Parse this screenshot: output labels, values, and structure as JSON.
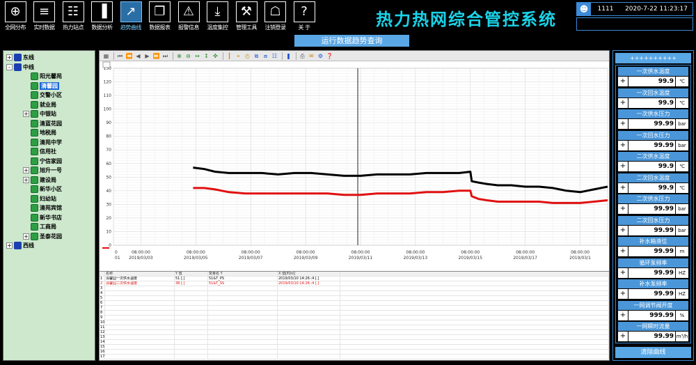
{
  "nav": [
    {
      "label": "全网分布",
      "icon": "globe-icon",
      "glyph": "⊕"
    },
    {
      "label": "实时数据",
      "icon": "document-icon",
      "glyph": "≡"
    },
    {
      "label": "热力站点",
      "icon": "network-icon",
      "glyph": "☷"
    },
    {
      "label": "数据分析",
      "icon": "bar-chart-icon",
      "glyph": "▐"
    },
    {
      "label": "趋势曲线",
      "icon": "trend-icon",
      "glyph": "↗"
    },
    {
      "label": "数据报表",
      "icon": "folder-icon",
      "glyph": "❐"
    },
    {
      "label": "报警信息",
      "icon": "warning-icon",
      "glyph": "⚠"
    },
    {
      "label": "温度集控",
      "icon": "download-icon",
      "glyph": "⤓"
    },
    {
      "label": "管理工具",
      "icon": "tools-icon",
      "glyph": "⚒"
    },
    {
      "label": "注销登录",
      "icon": "lock-icon",
      "glyph": "☖"
    },
    {
      "label": "关  于",
      "icon": "help-icon",
      "glyph": "?"
    }
  ],
  "active_nav": 4,
  "title": "热力热网综合管控系统",
  "user": {
    "id": "1111",
    "datetime": "2020-7-22 11:23:17"
  },
  "section_title": "运行数据趋势查询",
  "tree": [
    {
      "label": "东线",
      "level": 0,
      "expander": "+",
      "icon": "blue"
    },
    {
      "label": "中线",
      "level": 0,
      "expander": "-",
      "icon": "blue"
    },
    {
      "label": "阳光馨苑",
      "level": 1,
      "expander": "",
      "icon": "green"
    },
    {
      "label": "清馨园",
      "level": 1,
      "expander": "",
      "icon": "green",
      "selected": true
    },
    {
      "label": "交警小区",
      "level": 1,
      "expander": "",
      "icon": "green"
    },
    {
      "label": "就业局",
      "level": 1,
      "expander": "",
      "icon": "green"
    },
    {
      "label": "中银站",
      "level": 1,
      "expander": "+",
      "icon": "green"
    },
    {
      "label": "清蓝花园",
      "level": 1,
      "expander": "",
      "icon": "green"
    },
    {
      "label": "地税局",
      "level": 1,
      "expander": "",
      "icon": "green"
    },
    {
      "label": "清苑中学",
      "level": 1,
      "expander": "",
      "icon": "green"
    },
    {
      "label": "信用社",
      "level": 1,
      "expander": "",
      "icon": "green"
    },
    {
      "label": "宁信家园",
      "level": 1,
      "expander": "",
      "icon": "green"
    },
    {
      "label": "旭升一号",
      "level": 1,
      "expander": "+",
      "icon": "green"
    },
    {
      "label": "建设局",
      "level": 1,
      "expander": "+",
      "icon": "green"
    },
    {
      "label": "新华小区",
      "level": 1,
      "expander": "",
      "icon": "green"
    },
    {
      "label": "妇幼站",
      "level": 1,
      "expander": "",
      "icon": "green"
    },
    {
      "label": "清苑宾馆",
      "level": 1,
      "expander": "",
      "icon": "green"
    },
    {
      "label": "新华书店",
      "level": 1,
      "expander": "",
      "icon": "green"
    },
    {
      "label": "工商局",
      "level": 1,
      "expander": "",
      "icon": "green"
    },
    {
      "label": "圣泰花园",
      "level": 1,
      "expander": "+",
      "icon": "green"
    },
    {
      "label": "西线",
      "level": 0,
      "expander": "+",
      "icon": "blue"
    }
  ],
  "toolbar_icons": [
    "grid-icon",
    "first-icon",
    "prev-fast-icon",
    "prev-icon",
    "next-icon",
    "next-fast-icon",
    "last-icon",
    "zoom-in-icon",
    "zoom-out-icon",
    "zoom-x-icon",
    "zoom-y-icon",
    "pan-icon",
    "ruler-icon",
    "cursor-icon",
    "clock-icon",
    "copy-icon",
    "paste-icon",
    "table-icon",
    "pause-icon",
    "print-icon",
    "export-icon",
    "config-icon",
    "help-chart-icon"
  ],
  "chart_data": {
    "type": "line",
    "y_ticks": [
      0,
      10,
      20,
      30,
      40,
      50,
      60,
      70,
      80,
      90,
      100,
      110,
      120,
      130
    ],
    "ylim": [
      0,
      130
    ],
    "xlim": [
      0,
      18
    ],
    "x_tick_pairs": [
      {
        "pos": 1,
        "time": "08:00:00",
        "date": "2019/03/03"
      },
      {
        "pos": 3,
        "time": "08:00:00",
        "date": "2019/03/05"
      },
      {
        "pos": 5,
        "time": "08:00:00",
        "date": "2019/03/07"
      },
      {
        "pos": 7,
        "time": "08:00:00",
        "date": "2019/03/09"
      },
      {
        "pos": 9,
        "time": "08:00:00",
        "date": "2019/03/11"
      },
      {
        "pos": 11,
        "time": "08:00:00",
        "date": "2019/03/13"
      },
      {
        "pos": 13,
        "time": "08:00:00",
        "date": "2019/03/15"
      },
      {
        "pos": 15,
        "time": "08:00:00",
        "date": "2019/03/17"
      },
      {
        "pos": 17,
        "time": "08:00:00",
        "date": "2019/03/1"
      }
    ],
    "x_start_label": {
      "time": "0",
      "date": "01"
    },
    "cursor_x": 8.9,
    "series": [
      {
        "color": "#000000",
        "x": [
          2.9,
          3.3,
          3.7,
          4.2,
          4.8,
          5.4,
          6.0,
          6.6,
          7.2,
          7.8,
          8.4,
          9.0,
          9.6,
          10.2,
          10.8,
          11.4,
          12.0,
          12.6,
          13.0,
          13.05,
          13.3,
          13.6,
          14.0,
          14.5,
          15.0,
          15.5,
          16.0,
          16.5,
          17.0,
          17.5,
          18.0
        ],
        "y": [
          57,
          56,
          54,
          53,
          53,
          53,
          52,
          53,
          53,
          52,
          51,
          51,
          52,
          52,
          52,
          53,
          53,
          53,
          54,
          47,
          46,
          45,
          44,
          44,
          43,
          43,
          42,
          40,
          39,
          41,
          43
        ]
      },
      {
        "color": "#e01010",
        "x": [
          2.9,
          3.3,
          3.7,
          4.2,
          4.8,
          5.4,
          6.0,
          6.6,
          7.2,
          7.8,
          8.4,
          9.0,
          9.6,
          10.2,
          10.8,
          11.4,
          12.0,
          12.6,
          13.0,
          13.05,
          13.3,
          13.6,
          14.0,
          14.5,
          15.0,
          15.5,
          16.0,
          16.5,
          17.0,
          17.5,
          18.0
        ],
        "y": [
          42,
          42,
          41,
          39,
          38,
          38,
          38,
          38,
          38,
          38,
          37,
          37,
          38,
          38,
          38,
          39,
          39,
          40,
          40,
          36,
          34,
          33,
          32,
          32,
          32,
          32,
          31,
          31,
          31,
          32,
          33
        ]
      }
    ]
  },
  "table": {
    "headers": [
      "名称",
      "Y 值",
      "变量名 Y",
      "X 值[时间]"
    ],
    "rows": [
      {
        "no": "1",
        "cells": [
          "清馨园一次供水温度",
          "51 [.]",
          "51&T_PS",
          "2019/03/10 14:26::4 [.]"
        ],
        "color": "#000000"
      },
      {
        "no": "2",
        "cells": [
          "清馨园二次供水温度",
          "38 [.]",
          "51&T_SS",
          "2019/03/10 14:26::4 [.]"
        ],
        "color": "#e01010"
      }
    ],
    "row_numbers": [
      "1",
      "2",
      "3",
      "4",
      "5",
      "6",
      "7",
      "8",
      "9",
      "10",
      "11",
      "12",
      "13",
      "14",
      "15",
      "16",
      "17"
    ]
  },
  "right_panel": {
    "header": "++++++++++",
    "params": [
      {
        "label": "一次供水温度",
        "value": "99.9",
        "unit": "℃"
      },
      {
        "label": "一次回水温度",
        "value": "99.9",
        "unit": "℃"
      },
      {
        "label": "一次供水压力",
        "value": "99.99",
        "unit": "bar"
      },
      {
        "label": "一次回水压力",
        "value": "99.99",
        "unit": "bar"
      },
      {
        "label": "二次供水温度",
        "value": "99.9",
        "unit": "℃"
      },
      {
        "label": "二次回水温度",
        "value": "99.9",
        "unit": "℃"
      },
      {
        "label": "二次供水压力",
        "value": "99.99",
        "unit": "bar"
      },
      {
        "label": "二次回水压力",
        "value": "99.99",
        "unit": "bar"
      },
      {
        "label": "补水箱液位",
        "value": "99.99",
        "unit": "m"
      },
      {
        "label": "循环泵频率",
        "value": "99.99",
        "unit": "HZ"
      },
      {
        "label": "补水泵频率",
        "value": "99.99",
        "unit": "HZ"
      },
      {
        "label": "一网调节阀开度",
        "value": "999.99",
        "unit": "%"
      },
      {
        "label": "一网瞬时流量",
        "value": "99.99",
        "unit": "m³/h"
      }
    ],
    "plus_label": "+",
    "clear_label": "清除曲线"
  }
}
